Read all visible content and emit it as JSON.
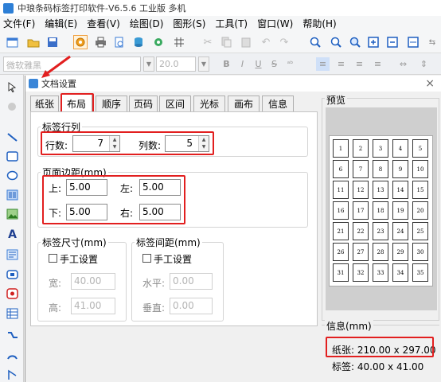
{
  "app": {
    "title": "中琅条码标签打印软件-V6.5.6 工业版 多机"
  },
  "menu": [
    "文件(F)",
    "编辑(E)",
    "查看(V)",
    "绘图(D)",
    "图形(S)",
    "工具(T)",
    "窗口(W)",
    "帮助(H)"
  ],
  "format_bar": {
    "font_name": "微软雅黑",
    "font_size": "20.0"
  },
  "dialog": {
    "title": "文档设置",
    "close": "×",
    "tabs": [
      "纸张",
      "布局",
      "顺序",
      "页码",
      "区间",
      "光标",
      "画布",
      "信息"
    ],
    "active_tab": "布局",
    "rows_cols": {
      "legend": "标签行列",
      "rows_label": "行数:",
      "rows": "7",
      "cols_label": "列数:",
      "cols": "5"
    },
    "margins": {
      "legend": "页面边距(mm)",
      "top_label": "上:",
      "top": "5.00",
      "left_label": "左:",
      "left": "5.00",
      "bottom_label": "下:",
      "bottom": "5.00",
      "right_label": "右:",
      "right": "5.00"
    },
    "label_size": {
      "legend": "标签尺寸(mm)",
      "manual": "手工设置",
      "width_label": "宽:",
      "width": "40.00",
      "height_label": "高:",
      "height": "41.00"
    },
    "label_gap": {
      "legend": "标签间距(mm)",
      "manual": "手工设置",
      "h_label": "水平:",
      "h": "0.00",
      "v_label": "垂直:",
      "v": "0.00"
    },
    "preview": {
      "legend": "预览",
      "cells": [
        "1",
        "2",
        "3",
        "4",
        "5",
        "6",
        "7",
        "8",
        "9",
        "10",
        "11",
        "12",
        "13",
        "14",
        "15",
        "16",
        "17",
        "18",
        "19",
        "20",
        "21",
        "22",
        "23",
        "24",
        "25",
        "26",
        "27",
        "28",
        "29",
        "30",
        "31",
        "32",
        "33",
        "34",
        "35"
      ]
    },
    "info": {
      "legend": "信息(mm)",
      "paper": "纸张: 210.00 x 297.00",
      "label": "标签: 40.00 x 41.00"
    }
  },
  "colors": {
    "highlight": "#e21f1f",
    "accent": "#2d7fd6"
  }
}
